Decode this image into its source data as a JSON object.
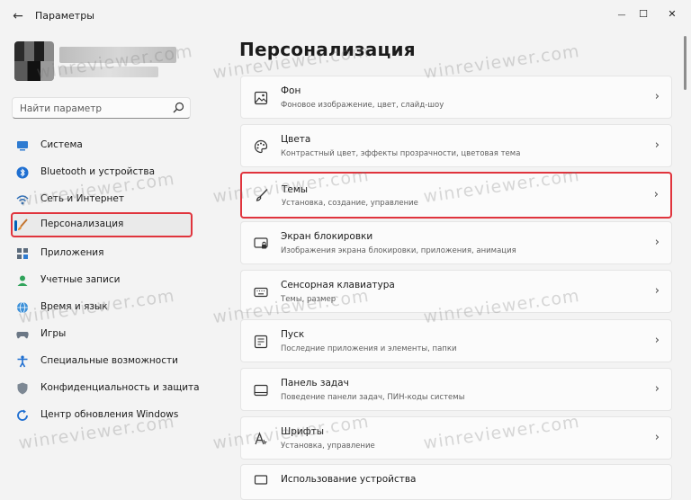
{
  "window": {
    "title": "Параметры",
    "back_glyph": "←",
    "minimize_glyph": "—",
    "maximize_glyph": "☐",
    "close_glyph": "✕"
  },
  "search": {
    "placeholder": "Найти параметр",
    "icon": "search-icon"
  },
  "sidebar": {
    "items": [
      {
        "label": "Система",
        "icon": "monitor-icon"
      },
      {
        "label": "Bluetooth и устройства",
        "icon": "bluetooth-icon"
      },
      {
        "label": "Сеть и Интернет",
        "icon": "wifi-icon"
      },
      {
        "label": "Персонализация",
        "icon": "brush-icon",
        "active": true
      },
      {
        "label": "Приложения",
        "icon": "apps-icon"
      },
      {
        "label": "Учетные записи",
        "icon": "user-icon"
      },
      {
        "label": "Время и язык",
        "icon": "globe-clock-icon"
      },
      {
        "label": "Игры",
        "icon": "gamepad-icon"
      },
      {
        "label": "Специальные возможности",
        "icon": "accessibility-icon"
      },
      {
        "label": "Конфиденциальность и защита",
        "icon": "shield-icon"
      },
      {
        "label": "Центр обновления Windows",
        "icon": "update-icon"
      }
    ]
  },
  "main": {
    "title": "Персонализация",
    "cards": [
      {
        "title": "Фон",
        "subtitle": "Фоновое изображение, цвет, слайд-шоу",
        "icon": "image-icon"
      },
      {
        "title": "Цвета",
        "subtitle": "Контрастный цвет, эффекты прозрачности, цветовая тема",
        "icon": "palette-icon"
      },
      {
        "title": "Темы",
        "subtitle": "Установка, создание, управление",
        "icon": "brush-icon",
        "highlighted": true
      },
      {
        "title": "Экран блокировки",
        "subtitle": "Изображения экрана блокировки, приложения, анимация",
        "icon": "lock-screen-icon"
      },
      {
        "title": "Сенсорная клавиатура",
        "subtitle": "Темы, размер",
        "icon": "keyboard-icon"
      },
      {
        "title": "Пуск",
        "subtitle": "Последние приложения и элементы, папки",
        "icon": "start-icon"
      },
      {
        "title": "Панель задач",
        "subtitle": "Поведение панели задач, ПИН-коды системы",
        "icon": "taskbar-icon"
      },
      {
        "title": "Шрифты",
        "subtitle": "Установка, управление",
        "icon": "fonts-icon"
      },
      {
        "title": "Использование устройства",
        "subtitle": "",
        "icon": "device-usage-icon"
      }
    ],
    "chevron": "›"
  },
  "watermark": "winreviewer.com",
  "colors": {
    "highlight_border": "#e0343d",
    "accent": "#005fb8",
    "background": "#f3f3f3",
    "card": "#fbfbfb"
  }
}
